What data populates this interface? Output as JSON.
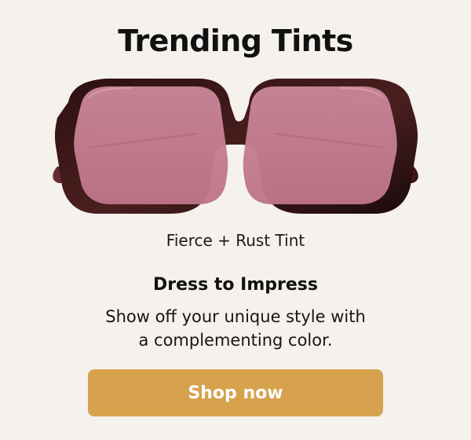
{
  "promo": {
    "title": "Trending Tints",
    "product_name": "Fierce + Rust Tint",
    "headline": "Dress to Impress",
    "body_line_1": "Show off your unique style with",
    "body_line_2": "a complementing color.",
    "cta_label": "Shop now",
    "product_image_alt": "sunglasses"
  },
  "colors": {
    "background": "#f5f1ec",
    "cta": "#d6a24e",
    "lens": "#c78293",
    "frame": "#3a1718"
  }
}
